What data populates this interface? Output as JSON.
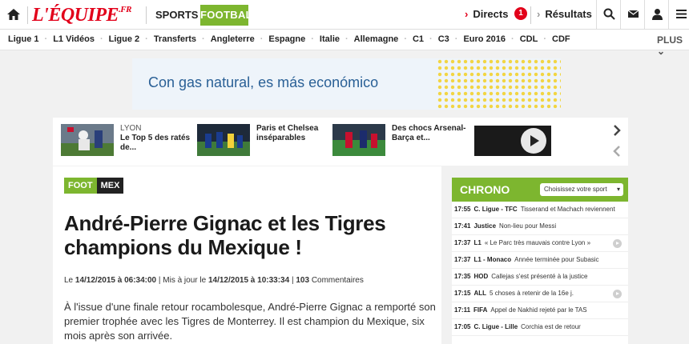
{
  "header": {
    "logo_main": "L'ÉQUIPE",
    "logo_suffix": ".FR",
    "sports_label": "SPORTS ▾",
    "active_section": "FOOTBALL",
    "directs_label": "Directs",
    "directs_count": "1",
    "results_label": "Résultats"
  },
  "subnav": {
    "items": [
      "Ligue 1",
      "L1 Vidéos",
      "Ligue 2",
      "Transferts",
      "Angleterre",
      "Espagne",
      "Italie",
      "Allemagne",
      "C1",
      "C3",
      "Euro 2016",
      "CDL",
      "CDF"
    ],
    "more_label": "PLUS"
  },
  "ad": {
    "text": "Con gas natural, es más económico"
  },
  "teasers": [
    {
      "tag": "LYON",
      "title": "Le Top 5 des ratés de..."
    },
    {
      "tag": "",
      "title": "Paris et Chelsea inséparables"
    },
    {
      "tag": "",
      "title": "Des chocs Arsenal-Barça et..."
    }
  ],
  "article": {
    "tag_sport": "FOOT",
    "tag_country": "MEX",
    "title": "André-Pierre Gignac et les Tigres champions du Mexique !",
    "meta_le": "Le",
    "published": "14/12/2015 à 06:34:00",
    "meta_updated_prefix": "| Mis à jour le",
    "updated": "14/12/2015 à 10:33:34",
    "comments_count": "103",
    "comments_label": "Commentaires",
    "lead": "À l'issue d'une finale retour rocambolesque, André-Pierre Gignac a remporté son premier trophée avec les Tigres de Monterrey. Il est champion du Mexique, six mois après son arrivée."
  },
  "chrono": {
    "title": "CHRONO",
    "select_label": "Choisissez votre sport",
    "rows": [
      {
        "time": "17:55",
        "cat": "C. Ligue - TFC",
        "headline": "Tisserand et Machach reviennent",
        "video": false
      },
      {
        "time": "17:41",
        "cat": "Justice",
        "headline": "Non-lieu pour Messi",
        "video": false
      },
      {
        "time": "17:37",
        "cat": "L1",
        "headline": "« Le Parc très mauvais contre Lyon »",
        "video": true
      },
      {
        "time": "17:37",
        "cat": "L1 - Monaco",
        "headline": "Année terminée pour Subasic",
        "video": false
      },
      {
        "time": "17:35",
        "cat": "HOD",
        "headline": "Callejas s'est présenté à la justice",
        "video": false
      },
      {
        "time": "17:15",
        "cat": "ALL",
        "headline": "5 choses à retenir de la 16e j.",
        "video": true
      },
      {
        "time": "17:11",
        "cat": "FIFA",
        "headline": "Appel de Nakhid rejeté par le TAS",
        "video": false
      },
      {
        "time": "17:05",
        "cat": "C. Ligue - Lille",
        "headline": "Corchia est de retour",
        "video": false
      }
    ]
  }
}
